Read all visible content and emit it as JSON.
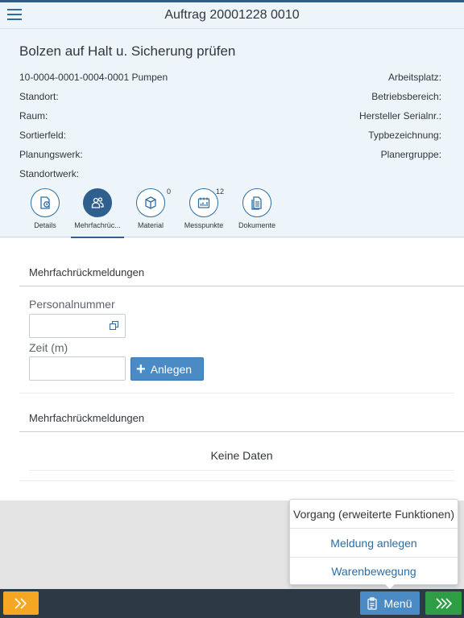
{
  "header": {
    "title": "Auftrag 20001228 0010"
  },
  "object": {
    "title": "Bolzen auf Halt u. Sicherung prüfen",
    "left_attributes": [
      "10-0004-0001-0004-0001 Pumpen",
      "Standort:",
      "Raum:",
      "Sortierfeld:",
      "Planungswerk:",
      "Standortwerk:"
    ],
    "right_attributes": [
      "Arbeitsplatz:",
      "Betriebsbereich:",
      "Hersteller Serialnr.:",
      "Typbezeichnung:",
      "Planergruppe:"
    ]
  },
  "tabs": [
    {
      "label": "Details",
      "icon": "details-icon",
      "count": ""
    },
    {
      "label": "Mehrfachrüc...",
      "icon": "people-icon",
      "count": "",
      "selected": true
    },
    {
      "label": "Material",
      "icon": "box-icon",
      "count": "0"
    },
    {
      "label": "Messpunkte",
      "icon": "measure-icon",
      "count": "12"
    },
    {
      "label": "Dokumente",
      "icon": "document-icon",
      "count": ""
    }
  ],
  "form": {
    "section_title": "Mehrfachrückmeldungen",
    "personal_label": "Personalnummer",
    "personal_value": "",
    "zeit_label": "Zeit (m)",
    "zeit_value": "",
    "anlegen_label": "Anlegen"
  },
  "table": {
    "section_title": "Mehrfachrückmeldungen",
    "no_data": "Keine Daten"
  },
  "popover": {
    "items": [
      "Vorgang (erweiterte Funktionen)",
      "Meldung anlegen",
      "Warenbewegung"
    ]
  },
  "footer": {
    "menu_label": "Menü"
  },
  "colors": {
    "accent": "#4a8ac5",
    "selected_tab": "#2e5f8f",
    "footer_bg": "#2d3a46",
    "orange_button": "#f5a623",
    "green_button": "#2e9d45"
  }
}
